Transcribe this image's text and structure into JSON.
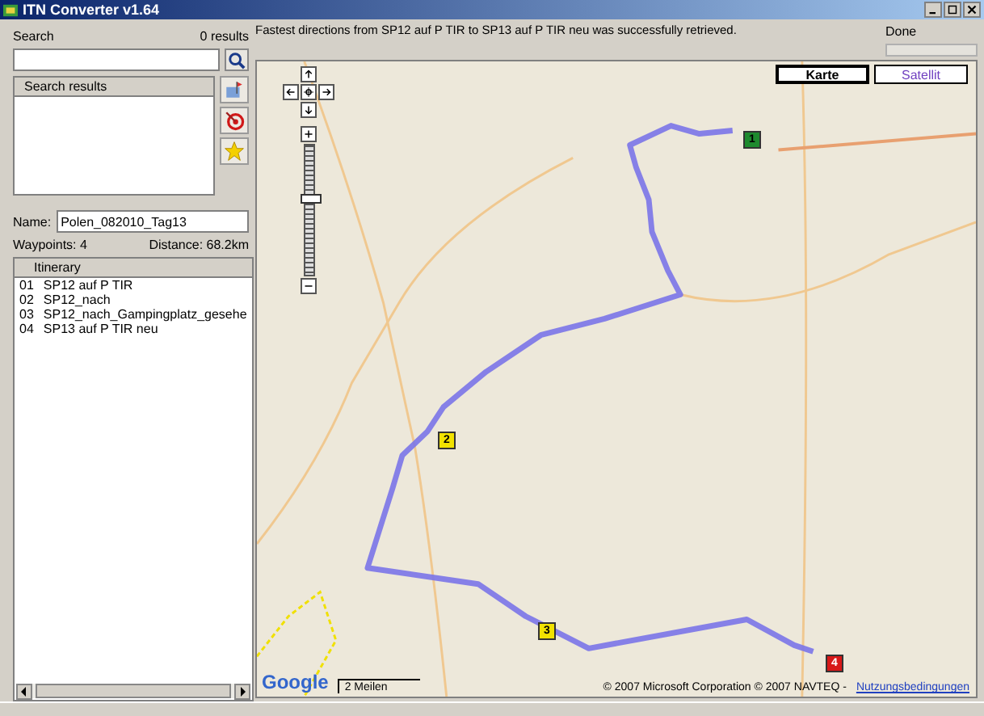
{
  "window": {
    "title": "ITN Converter v1.64"
  },
  "search": {
    "label": "Search",
    "count": "0 results",
    "results_header": "Search results"
  },
  "route": {
    "name_label": "Name:",
    "name_value": "Polen_082010_Tag13",
    "waypoints": "Waypoints: 4",
    "distance": "Distance: 68.2km"
  },
  "itinerary": {
    "header": "Itinerary",
    "rows": [
      {
        "index": "01",
        "name": "SP12 auf P TIR"
      },
      {
        "index": "02",
        "name": "SP12_nach"
      },
      {
        "index": "03",
        "name": "SP12_nach_Gampingplatz_gesehe"
      },
      {
        "index": "04",
        "name": "SP13 auf P TIR neu"
      }
    ]
  },
  "status": {
    "message": "Fastest directions from SP12 auf P TIR to SP13 auf P TIR neu was successfully retrieved.",
    "state": "Done",
    "level": 0
  },
  "map": {
    "zoom": {
      "level": 0.6
    },
    "view_buttons": [
      {
        "label": "Karte",
        "selected": true
      },
      {
        "label": "Satellit",
        "selected": false
      }
    ],
    "markers": [
      {
        "label": "1",
        "color": "#1e8a2e"
      },
      {
        "label": "2",
        "color": "#f2e200"
      },
      {
        "label": "3",
        "color": "#f2e200"
      },
      {
        "label": "4",
        "color": "#d81818"
      }
    ],
    "logo": "Google",
    "scale": "2 Meilen",
    "copyright": "© 2007 Microsoft Corporation © 2007 NAVTEQ -",
    "terms_link": "Nutzungsbedingungen"
  }
}
